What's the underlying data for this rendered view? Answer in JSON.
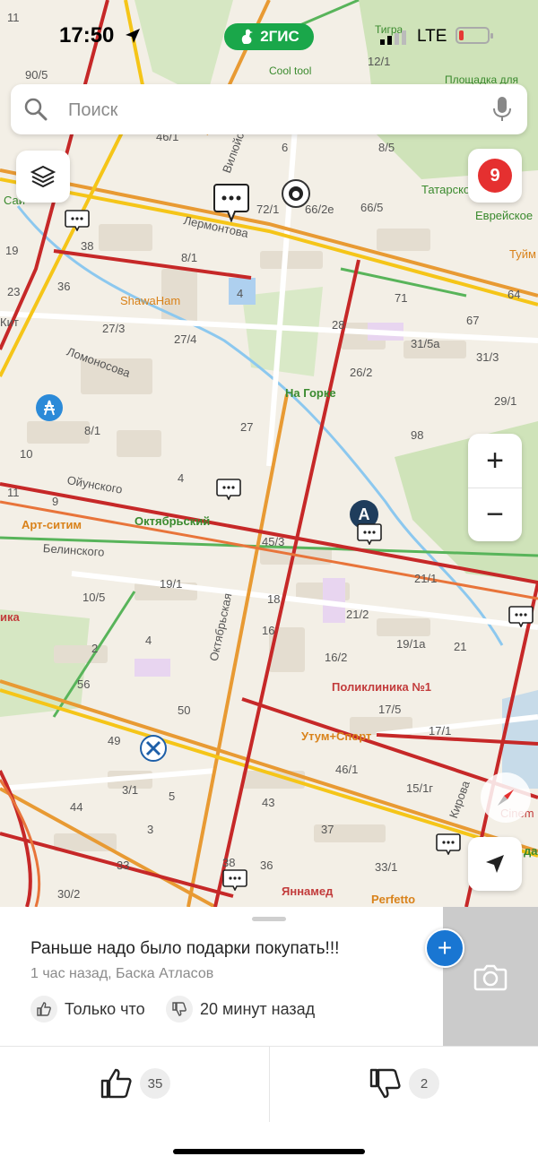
{
  "status_bar": {
    "time": "17:50",
    "brand": "2ГИС",
    "network": "LTE"
  },
  "search": {
    "placeholder": "Поиск"
  },
  "map_controls": {
    "notification_count": "9",
    "zoom_in": "+",
    "zoom_out": "−"
  },
  "map": {
    "streets": [
      "Лермонтова",
      "Ломоносова",
      "Ойунского",
      "Белинского",
      "Октябрьская",
      "Кирова",
      "Вилюйский"
    ],
    "house_numbers": [
      "90/5",
      "46/1",
      "6",
      "72/1",
      "66/2е",
      "66/5",
      "8/5",
      "12/1",
      "38",
      "36",
      "8/1",
      "4",
      "71",
      "67",
      "64",
      "27/3",
      "27/4",
      "28",
      "31/5а",
      "31/3",
      "26/2",
      "29/1",
      "8/1",
      "27",
      "98",
      "10",
      "4",
      "9",
      "11",
      "45/3",
      "19/1",
      "18",
      "10/5",
      "16",
      "21/1",
      "21/2",
      "19/1а",
      "21",
      "2",
      "4",
      "56",
      "16/2",
      "50",
      "17/5",
      "17/1",
      "49",
      "3/1",
      "5",
      "43",
      "46/1",
      "15/1г",
      "44",
      "3",
      "37",
      "33",
      "38",
      "36",
      "33/1",
      "30/2",
      "19",
      "23",
      "11"
    ],
    "places": {
      "tigra": "Тигра",
      "cool_tool": "Cool tool",
      "ploschadka": "Площадка для",
      "tatarskoe": "Татарско",
      "evreyskoe": "Еврейское",
      "tuyma": "Туйм",
      "shawaham": "ShawaHam",
      "na_gorke": "На Горке",
      "sai": "Сай",
      "kit": "Кит",
      "art_sitim": "Арт-ситим",
      "oktyabrsky": "Октябрьский",
      "ika": "ика",
      "poliklinika": "Поликлиника №1",
      "utum_sport": "Утум+Спорт",
      "cinem": "Cinem",
      "da": "да",
      "yannamed": "Яннамед",
      "perfetto": "Perfetto"
    }
  },
  "comment": {
    "text": "Раньше надо было подарки покупать!!!",
    "meta": "1 час назад, Баска Атласов",
    "like_time": "Только что",
    "dislike_time": "20 минут назад",
    "likes": "35",
    "dislikes": "2"
  },
  "colors": {
    "brand_green": "#1aa74a",
    "badge_red": "#e53030",
    "accent_blue": "#1976d2",
    "traffic_red": "#c62828",
    "traffic_yellow": "#f5c518"
  }
}
